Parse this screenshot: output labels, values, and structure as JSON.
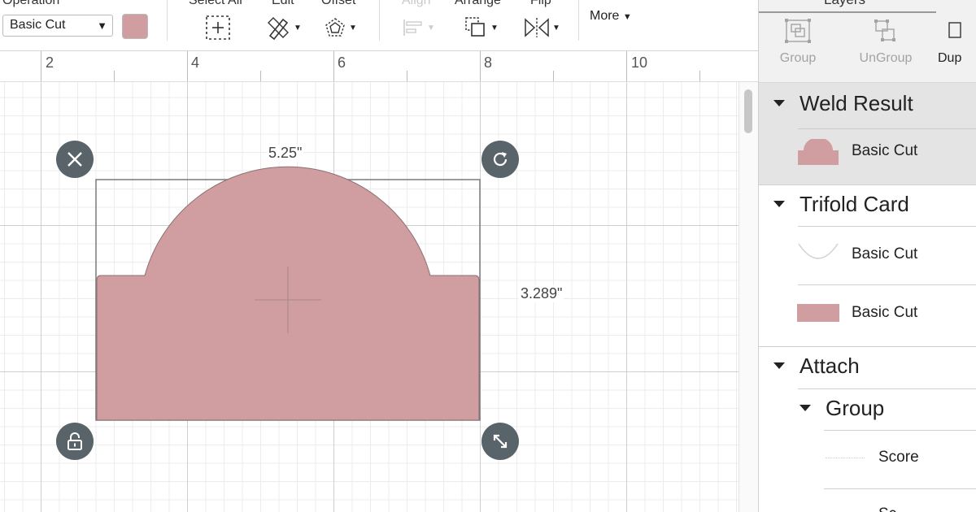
{
  "toolbar": {
    "operation_label": "Operation",
    "operation_value": "Basic Cut",
    "select_all_label": "Select All",
    "edit_label": "Edit",
    "offset_label": "Offset",
    "align_label": "Align",
    "arrange_label": "Arrange",
    "flip_label": "Flip",
    "more_label": "More",
    "swatch_color": "#d09da0"
  },
  "ruler": {
    "numbers": [
      "2",
      "4",
      "6",
      "8",
      "10"
    ]
  },
  "canvas": {
    "width_label": "5.25\"",
    "height_label": "3.289\"",
    "shape_color": "#d09da0"
  },
  "layers_panel": {
    "title": "Layers",
    "buttons": {
      "group": "Group",
      "ungroup": "UnGroup",
      "duplicate": "Dup"
    },
    "groups": [
      {
        "name": "Weld Result",
        "items": [
          "Basic Cut"
        ]
      },
      {
        "name": "Trifold Card",
        "items": [
          "Basic Cut",
          "Basic Cut"
        ]
      },
      {
        "name": "Attach",
        "subgroup": {
          "name": "Group",
          "items": [
            "Score",
            "Sc"
          ]
        }
      }
    ]
  }
}
